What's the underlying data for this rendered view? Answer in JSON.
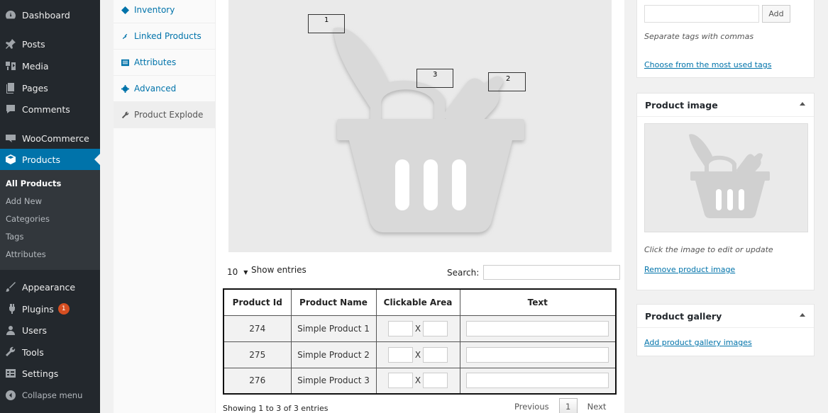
{
  "sidebar": {
    "items": [
      {
        "label": "Dashboard",
        "icon": "dashboard-icon"
      },
      {
        "label": "Posts",
        "icon": "pin-icon"
      },
      {
        "label": "Media",
        "icon": "media-icon"
      },
      {
        "label": "Pages",
        "icon": "page-icon"
      },
      {
        "label": "Comments",
        "icon": "comment-icon"
      },
      {
        "label": "WooCommerce",
        "icon": "woocommerce-icon"
      },
      {
        "label": "Products",
        "icon": "product-cube-icon"
      },
      {
        "label": "Appearance",
        "icon": "brush-icon"
      },
      {
        "label": "Plugins",
        "icon": "plug-icon",
        "badge": "1"
      },
      {
        "label": "Users",
        "icon": "user-icon"
      },
      {
        "label": "Tools",
        "icon": "wrench-icon"
      },
      {
        "label": "Settings",
        "icon": "settings-icon"
      },
      {
        "label": "Collapse menu",
        "icon": "collapse-arrow-icon"
      }
    ],
    "products_submenu": [
      "All Products",
      "Add New",
      "Categories",
      "Tags",
      "Attributes"
    ]
  },
  "product_tabs": [
    {
      "label": "Inventory",
      "icon": "inventory-tag-icon"
    },
    {
      "label": "Linked Products",
      "icon": "link-icon"
    },
    {
      "label": "Attributes",
      "icon": "attributes-list-icon"
    },
    {
      "label": "Advanced",
      "icon": "gear-icon"
    },
    {
      "label": "Product Explode",
      "icon": "wrench-icon"
    }
  ],
  "hotspots": [
    "1",
    "2",
    "3"
  ],
  "table": {
    "length_value": "10",
    "length_label": "Show entries",
    "search_label": "Search:",
    "headers": [
      "Product Id",
      "Product Name",
      "Clickable Area",
      "Text"
    ],
    "separator": "X",
    "rows": [
      {
        "id": "274",
        "name": "Simple Product 1"
      },
      {
        "id": "275",
        "name": "Simple Product 2"
      },
      {
        "id": "276",
        "name": "Simple Product 3"
      }
    ],
    "info": "Showing 1 to 3 of 3 entries",
    "pager": {
      "previous": "Previous",
      "current": "1",
      "next": "Next"
    }
  },
  "tags_box": {
    "add_label": "Add",
    "hint": "Separate tags with commas",
    "choose_link": "Choose from the most used tags"
  },
  "product_image_box": {
    "title": "Product image",
    "hint": "Click the image to edit or update",
    "remove_link": "Remove product image"
  },
  "gallery_box": {
    "title": "Product gallery",
    "add_link": "Add product gallery images"
  },
  "colors": {
    "admin_bar": "#23282d",
    "accent": "#0073aa",
    "badge": "#d54e21"
  }
}
